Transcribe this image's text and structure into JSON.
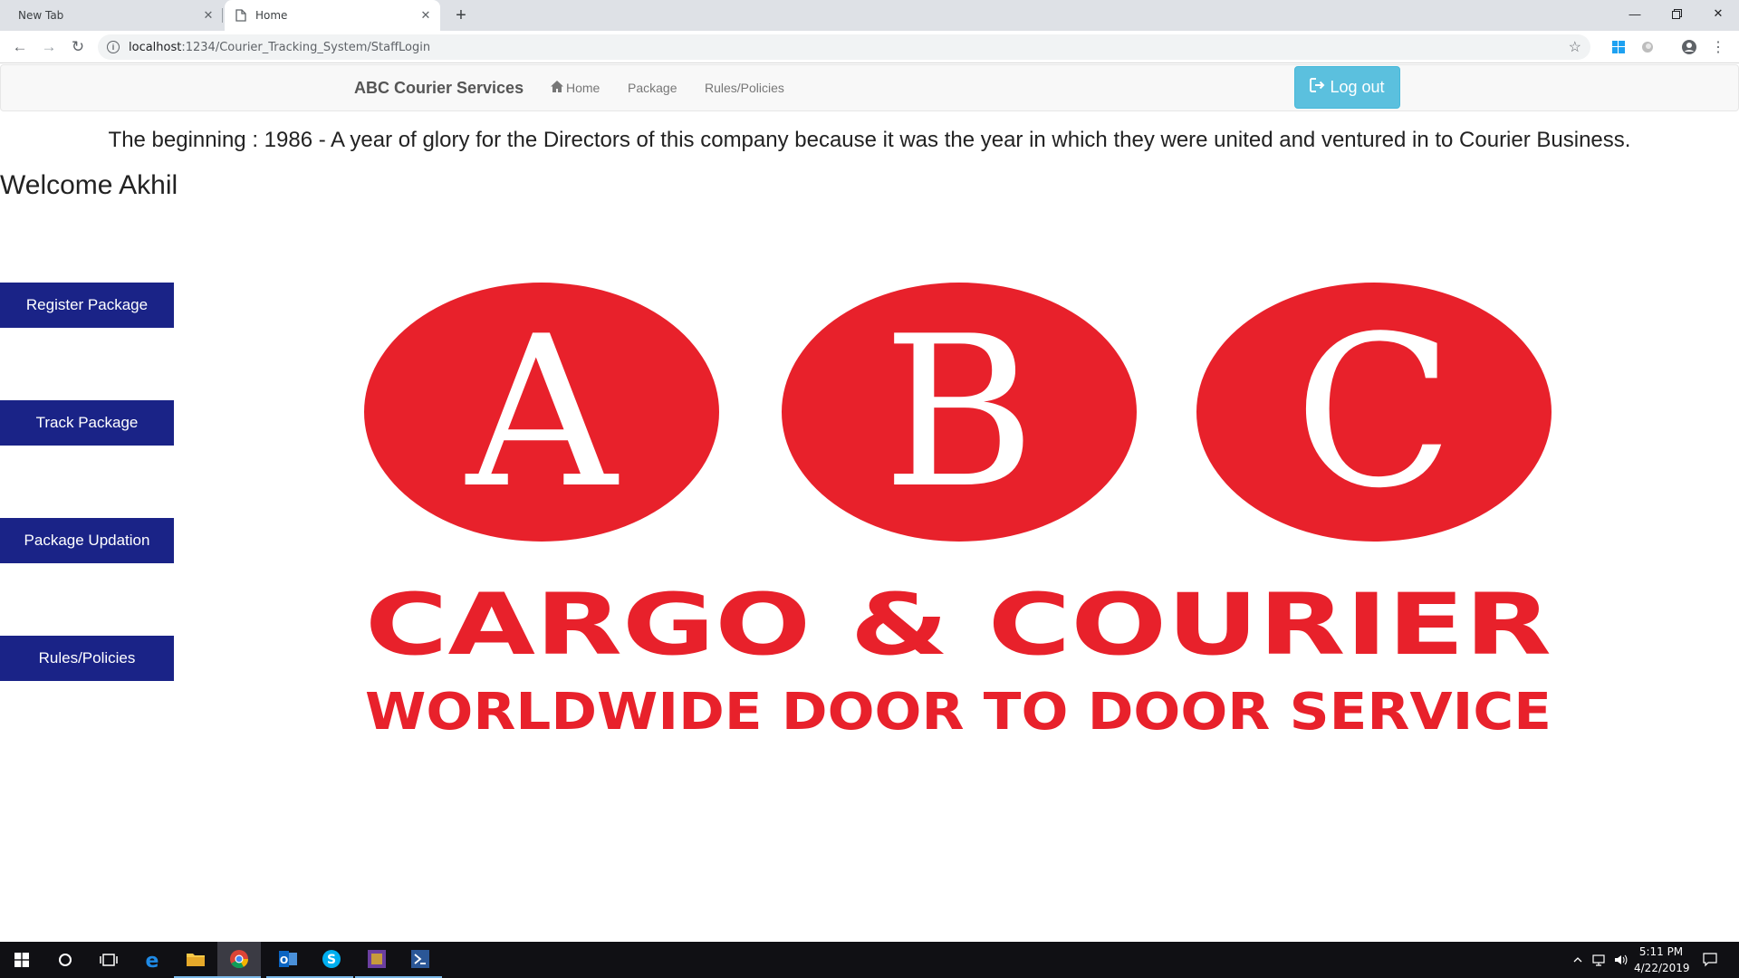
{
  "browser": {
    "tabs": [
      {
        "title": "New Tab"
      },
      {
        "title": "Home"
      }
    ],
    "url_host": "localhost",
    "url_path": ":1234/Courier_Tracking_System/StaffLogin"
  },
  "navbar": {
    "brand": "ABC Courier Services",
    "links": [
      "Home",
      "Package",
      "Rules/Policies"
    ],
    "logout_label": "Log out"
  },
  "intro_text": "The beginning : 1986 - A year of glory for the Directors of this company because it was the year in which they were united and ventured in to Courier Business.",
  "welcome_text": "Welcome Akhil",
  "side_buttons": [
    "Register Package",
    "Track Package",
    "Package Updation",
    "Rules/Policies"
  ],
  "logo": {
    "letters": [
      "A",
      "B",
      "C"
    ],
    "line1": "CARGO & COURIER",
    "line2": "WORLDWIDE DOOR TO DOOR SERVICE",
    "color": "#e8212b"
  },
  "taskbar": {
    "time": "5:11 PM",
    "date": "4/22/2019"
  },
  "colors": {
    "side_button_bg": "#1a2387",
    "logout_bg": "#5bc0de"
  }
}
